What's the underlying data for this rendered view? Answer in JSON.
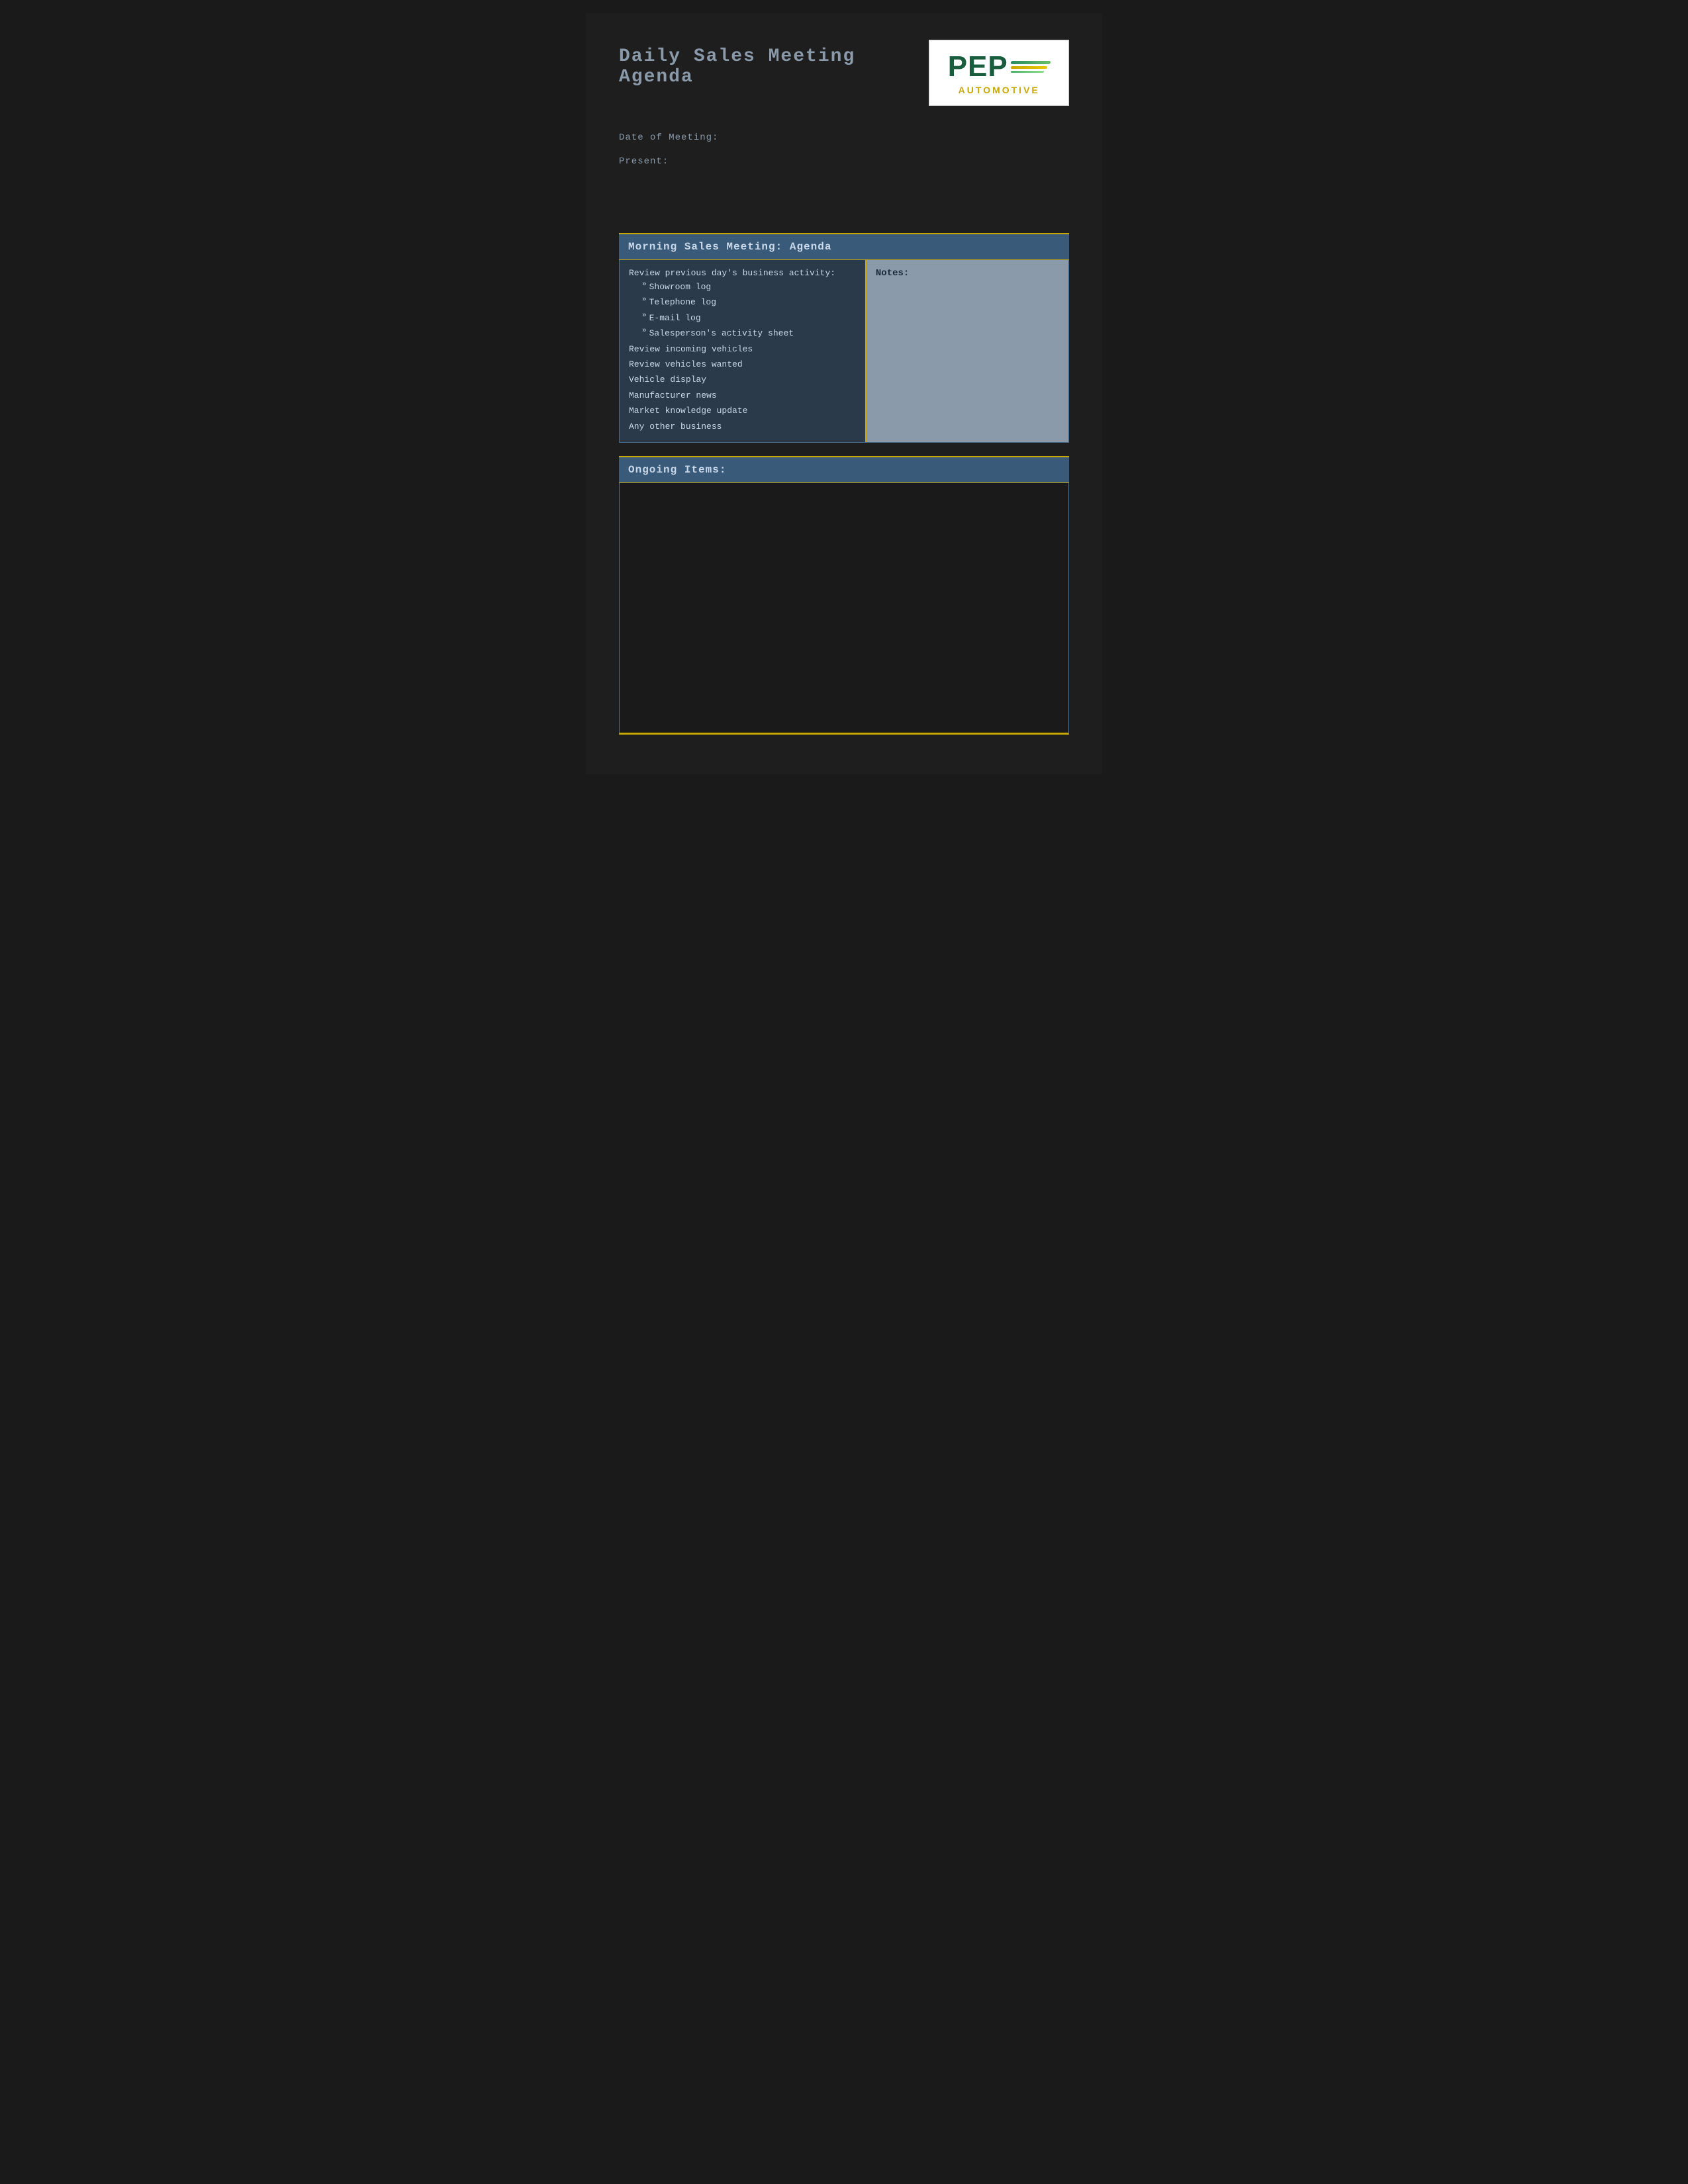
{
  "page": {
    "title": "Daily Sales Meeting Agenda",
    "background_color": "#1e1e1e"
  },
  "logo": {
    "pep_text": "PEP",
    "automotive_text": "AUTOMOTIVE"
  },
  "meta": {
    "date_label": "Date of Meeting:",
    "present_label": "Present:"
  },
  "morning_section": {
    "header": "Morning Sales Meeting: Agenda",
    "left_column": {
      "review_label": "Review previous day's business activity:",
      "sub_items": [
        "Showroom log",
        "Telephone log",
        "E-mail log",
        "Salesperson's activity sheet"
      ],
      "other_items": [
        "Review incoming vehicles",
        "Review vehicles wanted",
        "Vehicle display",
        "Manufacturer news",
        "Market knowledge update",
        "Any other business"
      ]
    },
    "right_column": {
      "notes_label": "Notes:"
    }
  },
  "ongoing_section": {
    "header": "Ongoing Items:"
  }
}
